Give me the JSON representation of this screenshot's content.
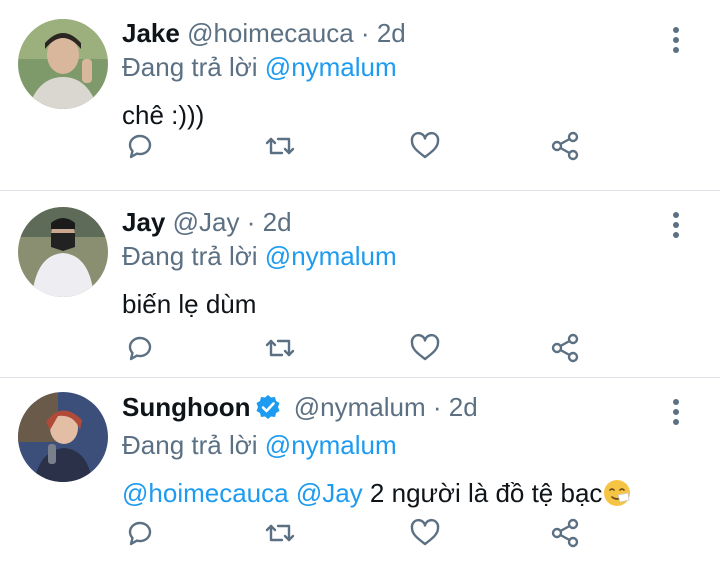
{
  "tweets": [
    {
      "name": "Jake",
      "handle": "@hoimecauca",
      "dot": "·",
      "time": "2d",
      "reply_prefix": "Đang trả lời",
      "reply_to": "@nymalum",
      "text": "chê :)))",
      "verified": false,
      "avatar_colors": [
        "#7f9a6a",
        "#c9c6b8"
      ]
    },
    {
      "name": "Jay",
      "handle": "@Jay",
      "dot": "·",
      "time": "2d",
      "reply_prefix": "Đang trả lời",
      "reply_to": "@nymalum",
      "text": "biến lẹ dùm",
      "verified": false,
      "avatar_colors": [
        "#8a8f72",
        "#e9e9ee"
      ]
    },
    {
      "name": "Sunghoon",
      "handle": "@nymalum",
      "dot": "·",
      "time": "2d",
      "reply_prefix": "Đang trả lời",
      "reply_to": "@nymalum",
      "mention1": "@hoimecauca",
      "mention2": "@Jay",
      "text": "2 người là đồ tệ bạc",
      "verified": true,
      "avatar_colors": [
        "#b04b3a",
        "#3c4f7a"
      ]
    }
  ],
  "icons": {
    "more": "more-vertical-icon",
    "reply": "reply-icon",
    "retweet": "retweet-icon",
    "like": "heart-icon",
    "share": "share-icon",
    "verified": "verified-badge-icon",
    "emoji": "sneezing-face-emoji"
  },
  "colors": {
    "icon": "#5b7083",
    "mention": "#1d9bf0",
    "verified": "#1d9bf0",
    "separator": "#dfe3e8"
  }
}
